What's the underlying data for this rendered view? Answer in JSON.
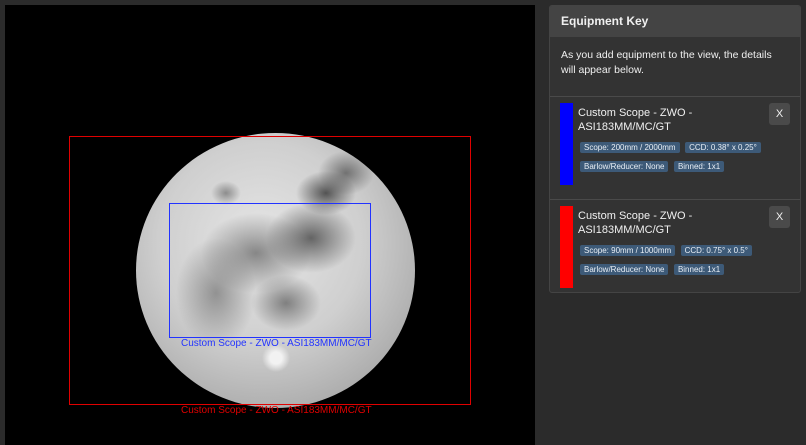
{
  "viewer": {
    "fovs": [
      {
        "label": "Custom Scope - ZWO - ASI183MM/MC/GT",
        "color": "#2233ff"
      },
      {
        "label": "Custom Scope - ZWO - ASI183MM/MC/GT",
        "color": "#e00000"
      }
    ]
  },
  "equipment_key": {
    "title": "Equipment Key",
    "intro": "As you add equipment to the view, the details will appear below.",
    "items": [
      {
        "color": "#0000ff",
        "name": "Custom Scope - ZWO - ASI183MM/MC/GT",
        "scope": "Scope: 200mm / 2000mm",
        "ccd": "CCD: 0.38° x 0.25°",
        "barlow": "Barlow/Reducer: None",
        "binned": "Binned: 1x1",
        "remove_label": "X"
      },
      {
        "color": "#ff0000",
        "name": "Custom Scope - ZWO - ASI183MM/MC/GT",
        "scope": "Scope: 90mm / 1000mm",
        "ccd": "CCD: 0.75° x 0.5°",
        "barlow": "Barlow/Reducer: None",
        "binned": "Binned: 1x1",
        "remove_label": "X"
      }
    ]
  }
}
